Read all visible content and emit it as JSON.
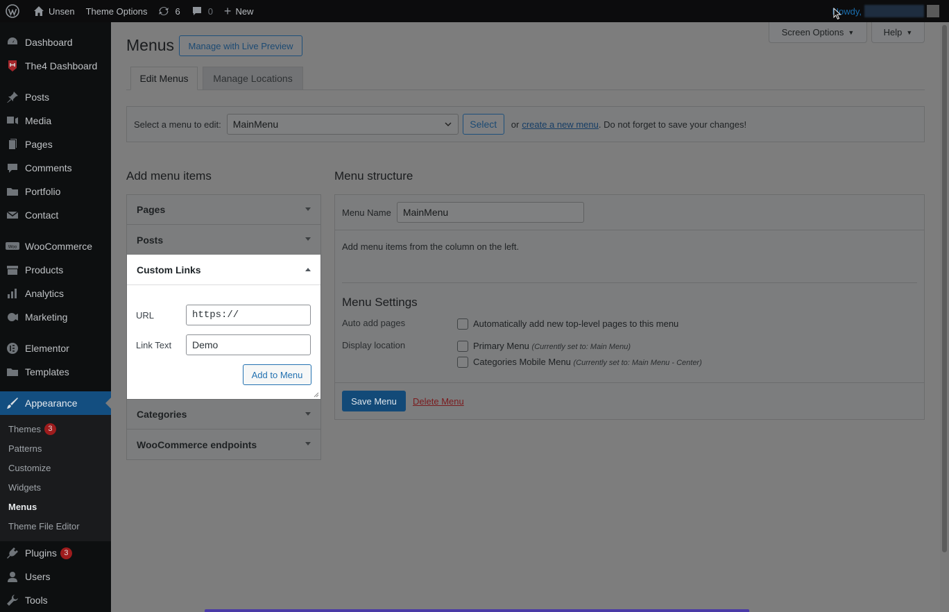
{
  "adminbar": {
    "site_name": "Unsen",
    "theme_options": "Theme Options",
    "updates_count": "6",
    "comments_count": "0",
    "new_label": "New",
    "howdy": "Howdy,"
  },
  "sidebar": {
    "items": [
      {
        "label": "Dashboard",
        "icon": "dashboard-icon"
      },
      {
        "label": "The4 Dashboard",
        "icon": "the4-icon"
      },
      {
        "label": "Posts",
        "icon": "pin-icon"
      },
      {
        "label": "Media",
        "icon": "media-icon"
      },
      {
        "label": "Pages",
        "icon": "pages-icon"
      },
      {
        "label": "Comments",
        "icon": "comments-icon"
      },
      {
        "label": "Portfolio",
        "icon": "folder-icon"
      },
      {
        "label": "Contact",
        "icon": "mail-icon"
      },
      {
        "label": "WooCommerce",
        "icon": "woo-icon"
      },
      {
        "label": "Products",
        "icon": "archive-icon"
      },
      {
        "label": "Analytics",
        "icon": "chart-icon"
      },
      {
        "label": "Marketing",
        "icon": "megaphone-icon"
      },
      {
        "label": "Elementor",
        "icon": "elementor-icon"
      },
      {
        "label": "Templates",
        "icon": "folder-icon"
      },
      {
        "label": "Appearance",
        "icon": "brush-icon"
      },
      {
        "label": "Plugins",
        "icon": "plug-icon",
        "badge": "3"
      },
      {
        "label": "Users",
        "icon": "user-icon"
      },
      {
        "label": "Tools",
        "icon": "wrench-icon"
      }
    ],
    "appearance_sub": [
      {
        "label": "Themes",
        "badge": "3"
      },
      {
        "label": "Patterns"
      },
      {
        "label": "Customize"
      },
      {
        "label": "Widgets"
      },
      {
        "label": "Menus"
      },
      {
        "label": "Theme File Editor"
      }
    ]
  },
  "header": {
    "title": "Menus",
    "live_preview": "Manage with Live Preview",
    "screen_options": "Screen Options",
    "help": "Help"
  },
  "tabs": [
    {
      "label": "Edit Menus",
      "active": true
    },
    {
      "label": "Manage Locations",
      "active": false
    }
  ],
  "select_menu": {
    "label": "Select a menu to edit:",
    "selected": "MainMenu",
    "button": "Select",
    "or": "or",
    "create_link": "create a new menu",
    "reminder": ". Do not forget to save your changes!"
  },
  "add_items": {
    "heading": "Add menu items",
    "sections": [
      "Pages",
      "Posts",
      "Custom Links",
      "Categories",
      "WooCommerce endpoints"
    ],
    "custom_links": {
      "url_label": "URL",
      "url_value": "https://",
      "link_text_label": "Link Text",
      "link_text_value": "Demo",
      "add_button": "Add to Menu"
    }
  },
  "structure": {
    "heading": "Menu structure",
    "menu_name_label": "Menu Name",
    "menu_name_value": "MainMenu",
    "instruction": "Add menu items from the column on the left.",
    "settings_title": "Menu Settings",
    "auto_add_label": "Auto add pages",
    "auto_add_text": "Automatically add new top-level pages to this menu",
    "display_location_label": "Display location",
    "locations": [
      {
        "name": "Primary Menu",
        "note": "(Currently set to: Main Menu)"
      },
      {
        "name": "Categories Mobile Menu",
        "note": "(Currently set to: Main Menu - Center)"
      }
    ],
    "save_button": "Save Menu",
    "delete_link": "Delete Menu"
  }
}
